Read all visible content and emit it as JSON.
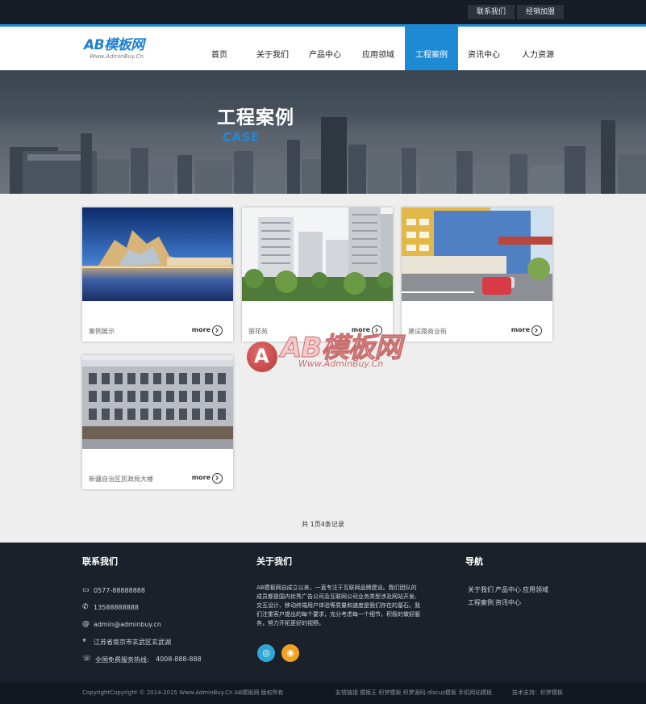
{
  "topbar": {
    "contact": "联系我们",
    "join": "经销加盟"
  },
  "logo": {
    "main": "AB模板网",
    "sub": "Www.AdminBuy.Cn"
  },
  "nav": [
    "首页",
    "关于我们",
    "产品中心",
    "应用领域",
    "工程案例",
    "资讯中心",
    "人力资源"
  ],
  "banner": {
    "title": "工程案例",
    "subtitle": "CASE"
  },
  "cases": [
    {
      "caption": "案例展示",
      "more": "more"
    },
    {
      "caption": "丽花苑",
      "more": "more"
    },
    {
      "caption": "建设路商业街",
      "more": "more"
    },
    {
      "caption": "新疆自治区民政局大楼",
      "more": "more"
    }
  ],
  "pagination": "共 1页4条记录",
  "watermark": {
    "main": "AB模板网",
    "sub": "Www.AdminBuy.Cn"
  },
  "footer": {
    "contact": {
      "title": "联系我们",
      "fax": "0577-88888888",
      "phone": "13588888888",
      "email": "admin@adminbuy.cn",
      "address": "江苏省南京市玄武区玄武湖",
      "hotline_label": "全国免费服务热线:",
      "hotline": "4008-888-888"
    },
    "about": {
      "title": "关于我们",
      "text": "AB模板网自成立以来，一直专注于互联网品牌建设。我们团队的成员都是国内优秀广告公司及互联网公司业务类型涉及网站开发、交互设计、移动终端用户体验等质量和速度是我们存在的基石。我们注重客户提出的每个要求，充分考虑每一个细节，积极的做好服务，努力开拓更好的视野。"
    },
    "nav": {
      "title": "导航",
      "row1": [
        "关于我们",
        "产品中心",
        "应用领域"
      ],
      "row2": [
        "工程案例",
        "资讯中心"
      ]
    },
    "copyright": "CopyrightCopyright © 2014-2015 Www.AdminBuy.Cn AB模板网 版权所有",
    "links_label": "友情链接",
    "links": [
      "模板王",
      "织梦模板",
      "织梦源码",
      "discuz模板",
      "手机网站模板"
    ],
    "tech": "技术支持：织梦模板"
  },
  "colors": {
    "accent": "#1e8ad6",
    "dark": "#1a212b",
    "topbar": "#151c25"
  }
}
